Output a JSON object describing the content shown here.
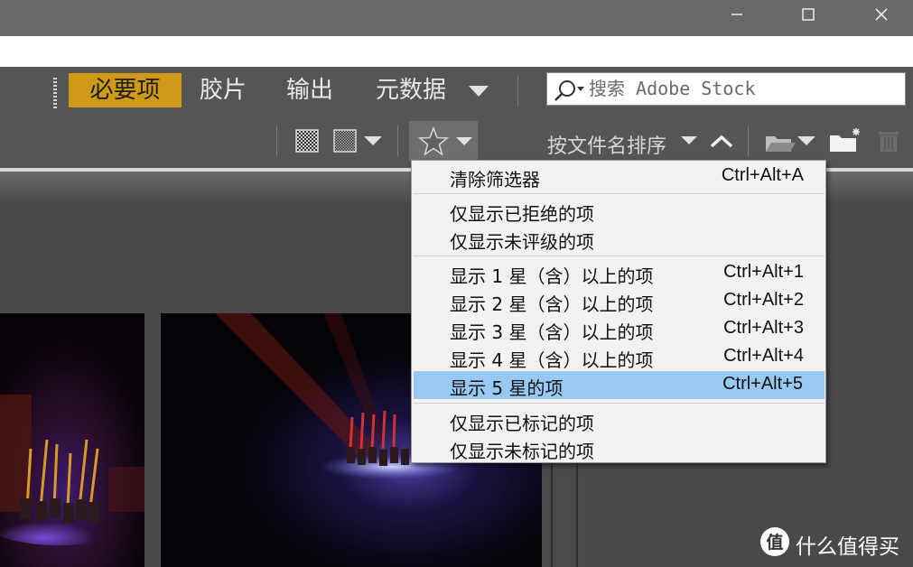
{
  "window_controls": {
    "minimize": "minimize-icon",
    "maximize": "maximize-icon",
    "close": "close-icon"
  },
  "workspace": {
    "tabs": [
      {
        "label": "必要项",
        "active": true
      },
      {
        "label": "胶片"
      },
      {
        "label": "输出"
      },
      {
        "label": "元数据"
      }
    ],
    "more_icon": "chevron-down-icon"
  },
  "search": {
    "placeholder": "搜索 Adobe Stock",
    "icon": "search-icon"
  },
  "toolbar": {
    "sort_label": "按文件名排序",
    "icons": [
      "quality-icon",
      "thumbnail-quality-icon",
      "star-filter-icon",
      "sort-ascending-icon",
      "open-folder-icon",
      "new-folder-icon",
      "trash-icon"
    ]
  },
  "filter_menu": {
    "items": [
      {
        "label": "清除筛选器",
        "shortcut": "Ctrl+Alt+A"
      },
      {
        "label": "仅显示已拒绝的项",
        "shortcut": ""
      },
      {
        "label": "仅显示未评级的项",
        "shortcut": ""
      },
      {
        "label": "显示 1 星（含）以上的项",
        "shortcut": "Ctrl+Alt+1"
      },
      {
        "label": "显示 2 星（含）以上的项",
        "shortcut": "Ctrl+Alt+2"
      },
      {
        "label": "显示 3 星（含）以上的项",
        "shortcut": "Ctrl+Alt+3"
      },
      {
        "label": "显示 4 星（含）以上的项",
        "shortcut": "Ctrl+Alt+4"
      },
      {
        "label": "显示 5 星的项",
        "shortcut": "Ctrl+Alt+5",
        "highlighted": true
      },
      {
        "label": "仅显示已标记的项",
        "shortcut": ""
      },
      {
        "label": "仅显示未标记的项",
        "shortcut": ""
      }
    ],
    "highlight_color": "#99c9f2"
  },
  "watermark": {
    "text": "什么值得买",
    "logo_glyph": "值"
  },
  "colors": {
    "accent": "#d09a16",
    "panel": "#555555",
    "titlebar": "#696969"
  }
}
